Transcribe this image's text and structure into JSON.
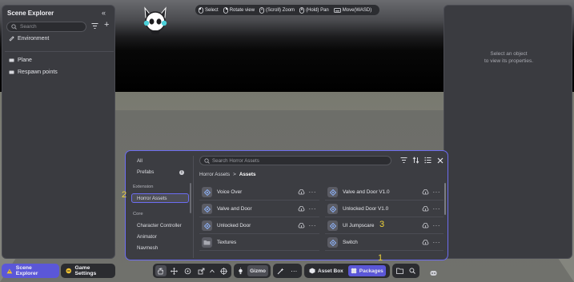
{
  "scene_explorer": {
    "title": "Scene Explorer",
    "search_placeholder": "Search",
    "items": [
      {
        "label": "Environment"
      },
      {
        "label": "Plane"
      },
      {
        "label": "Respawn points"
      }
    ]
  },
  "properties": {
    "hint_line1": "Select an object",
    "hint_line2": "to view its properties."
  },
  "hints": [
    {
      "label": "Select",
      "icon": "mouse-left-icon"
    },
    {
      "label": "Rotate view",
      "icon": "mouse-right-icon"
    },
    {
      "label": "(Scroll) Zoom",
      "icon": "mouse-scroll-icon"
    },
    {
      "label": "(Hold) Pan",
      "icon": "mouse-middle-icon"
    },
    {
      "label": "Move(WASD)",
      "icon": "keyboard-icon"
    }
  ],
  "asset_browser": {
    "categories_top": [
      {
        "label": "All"
      },
      {
        "label": "Prefabs"
      }
    ],
    "section_extension": "Extension",
    "selected_category": "Horror Assets",
    "section_core": "Core",
    "categories_core": [
      {
        "label": "Character Controller"
      },
      {
        "label": "Animator"
      },
      {
        "label": "Navmesh"
      }
    ],
    "search_placeholder": "Search Horror Assets",
    "breadcrumb": {
      "root": "Horror Assets",
      "separator": ">",
      "current": "Assets"
    },
    "assets_left": [
      {
        "name": "Voice Over",
        "icon": "prefab-icon"
      },
      {
        "name": "Valve and Door",
        "icon": "prefab-icon"
      },
      {
        "name": "Unlocked Door",
        "icon": "prefab-icon"
      },
      {
        "name": "Textures",
        "icon": "folder-icon"
      }
    ],
    "assets_right": [
      {
        "name": "Valve and Door V1.0",
        "icon": "prefab-icon"
      },
      {
        "name": "Unlocked Door V1.0",
        "icon": "prefab-icon"
      },
      {
        "name": "UI Jumpscare",
        "icon": "prefab-icon"
      },
      {
        "name": "Switch",
        "icon": "prefab-icon"
      }
    ],
    "more_label": "···"
  },
  "annotations": {
    "one": "1",
    "two": "2",
    "three": "3"
  },
  "bottom_bar": {
    "scene_explorer_tab": "Scene Explorer",
    "game_settings_tab": "Game Settings",
    "gizmo_label": "Gizmo",
    "asset_box_label": "Asset Box",
    "packages_label": "Packages"
  },
  "colors": {
    "accent": "#6d6df0",
    "annotation": "#f1d53a",
    "panel": "#3a3b40",
    "sky": "#000000",
    "ground": "#7f8079"
  }
}
